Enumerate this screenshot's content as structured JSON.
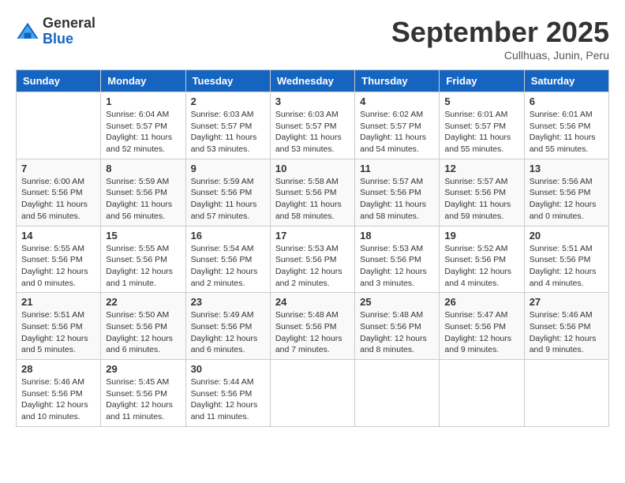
{
  "logo": {
    "general": "General",
    "blue": "Blue"
  },
  "header": {
    "month": "September 2025",
    "location": "Cullhuas, Junin, Peru"
  },
  "weekdays": [
    "Sunday",
    "Monday",
    "Tuesday",
    "Wednesday",
    "Thursday",
    "Friday",
    "Saturday"
  ],
  "weeks": [
    [
      {
        "day": "",
        "info": ""
      },
      {
        "day": "1",
        "info": "Sunrise: 6:04 AM\nSunset: 5:57 PM\nDaylight: 11 hours\nand 52 minutes."
      },
      {
        "day": "2",
        "info": "Sunrise: 6:03 AM\nSunset: 5:57 PM\nDaylight: 11 hours\nand 53 minutes."
      },
      {
        "day": "3",
        "info": "Sunrise: 6:03 AM\nSunset: 5:57 PM\nDaylight: 11 hours\nand 53 minutes."
      },
      {
        "day": "4",
        "info": "Sunrise: 6:02 AM\nSunset: 5:57 PM\nDaylight: 11 hours\nand 54 minutes."
      },
      {
        "day": "5",
        "info": "Sunrise: 6:01 AM\nSunset: 5:57 PM\nDaylight: 11 hours\nand 55 minutes."
      },
      {
        "day": "6",
        "info": "Sunrise: 6:01 AM\nSunset: 5:56 PM\nDaylight: 11 hours\nand 55 minutes."
      }
    ],
    [
      {
        "day": "7",
        "info": "Sunrise: 6:00 AM\nSunset: 5:56 PM\nDaylight: 11 hours\nand 56 minutes."
      },
      {
        "day": "8",
        "info": "Sunrise: 5:59 AM\nSunset: 5:56 PM\nDaylight: 11 hours\nand 56 minutes."
      },
      {
        "day": "9",
        "info": "Sunrise: 5:59 AM\nSunset: 5:56 PM\nDaylight: 11 hours\nand 57 minutes."
      },
      {
        "day": "10",
        "info": "Sunrise: 5:58 AM\nSunset: 5:56 PM\nDaylight: 11 hours\nand 58 minutes."
      },
      {
        "day": "11",
        "info": "Sunrise: 5:57 AM\nSunset: 5:56 PM\nDaylight: 11 hours\nand 58 minutes."
      },
      {
        "day": "12",
        "info": "Sunrise: 5:57 AM\nSunset: 5:56 PM\nDaylight: 11 hours\nand 59 minutes."
      },
      {
        "day": "13",
        "info": "Sunrise: 5:56 AM\nSunset: 5:56 PM\nDaylight: 12 hours\nand 0 minutes."
      }
    ],
    [
      {
        "day": "14",
        "info": "Sunrise: 5:55 AM\nSunset: 5:56 PM\nDaylight: 12 hours\nand 0 minutes."
      },
      {
        "day": "15",
        "info": "Sunrise: 5:55 AM\nSunset: 5:56 PM\nDaylight: 12 hours\nand 1 minute."
      },
      {
        "day": "16",
        "info": "Sunrise: 5:54 AM\nSunset: 5:56 PM\nDaylight: 12 hours\nand 2 minutes."
      },
      {
        "day": "17",
        "info": "Sunrise: 5:53 AM\nSunset: 5:56 PM\nDaylight: 12 hours\nand 2 minutes."
      },
      {
        "day": "18",
        "info": "Sunrise: 5:53 AM\nSunset: 5:56 PM\nDaylight: 12 hours\nand 3 minutes."
      },
      {
        "day": "19",
        "info": "Sunrise: 5:52 AM\nSunset: 5:56 PM\nDaylight: 12 hours\nand 4 minutes."
      },
      {
        "day": "20",
        "info": "Sunrise: 5:51 AM\nSunset: 5:56 PM\nDaylight: 12 hours\nand 4 minutes."
      }
    ],
    [
      {
        "day": "21",
        "info": "Sunrise: 5:51 AM\nSunset: 5:56 PM\nDaylight: 12 hours\nand 5 minutes."
      },
      {
        "day": "22",
        "info": "Sunrise: 5:50 AM\nSunset: 5:56 PM\nDaylight: 12 hours\nand 6 minutes."
      },
      {
        "day": "23",
        "info": "Sunrise: 5:49 AM\nSunset: 5:56 PM\nDaylight: 12 hours\nand 6 minutes."
      },
      {
        "day": "24",
        "info": "Sunrise: 5:48 AM\nSunset: 5:56 PM\nDaylight: 12 hours\nand 7 minutes."
      },
      {
        "day": "25",
        "info": "Sunrise: 5:48 AM\nSunset: 5:56 PM\nDaylight: 12 hours\nand 8 minutes."
      },
      {
        "day": "26",
        "info": "Sunrise: 5:47 AM\nSunset: 5:56 PM\nDaylight: 12 hours\nand 9 minutes."
      },
      {
        "day": "27",
        "info": "Sunrise: 5:46 AM\nSunset: 5:56 PM\nDaylight: 12 hours\nand 9 minutes."
      }
    ],
    [
      {
        "day": "28",
        "info": "Sunrise: 5:46 AM\nSunset: 5:56 PM\nDaylight: 12 hours\nand 10 minutes."
      },
      {
        "day": "29",
        "info": "Sunrise: 5:45 AM\nSunset: 5:56 PM\nDaylight: 12 hours\nand 11 minutes."
      },
      {
        "day": "30",
        "info": "Sunrise: 5:44 AM\nSunset: 5:56 PM\nDaylight: 12 hours\nand 11 minutes."
      },
      {
        "day": "",
        "info": ""
      },
      {
        "day": "",
        "info": ""
      },
      {
        "day": "",
        "info": ""
      },
      {
        "day": "",
        "info": ""
      }
    ]
  ]
}
